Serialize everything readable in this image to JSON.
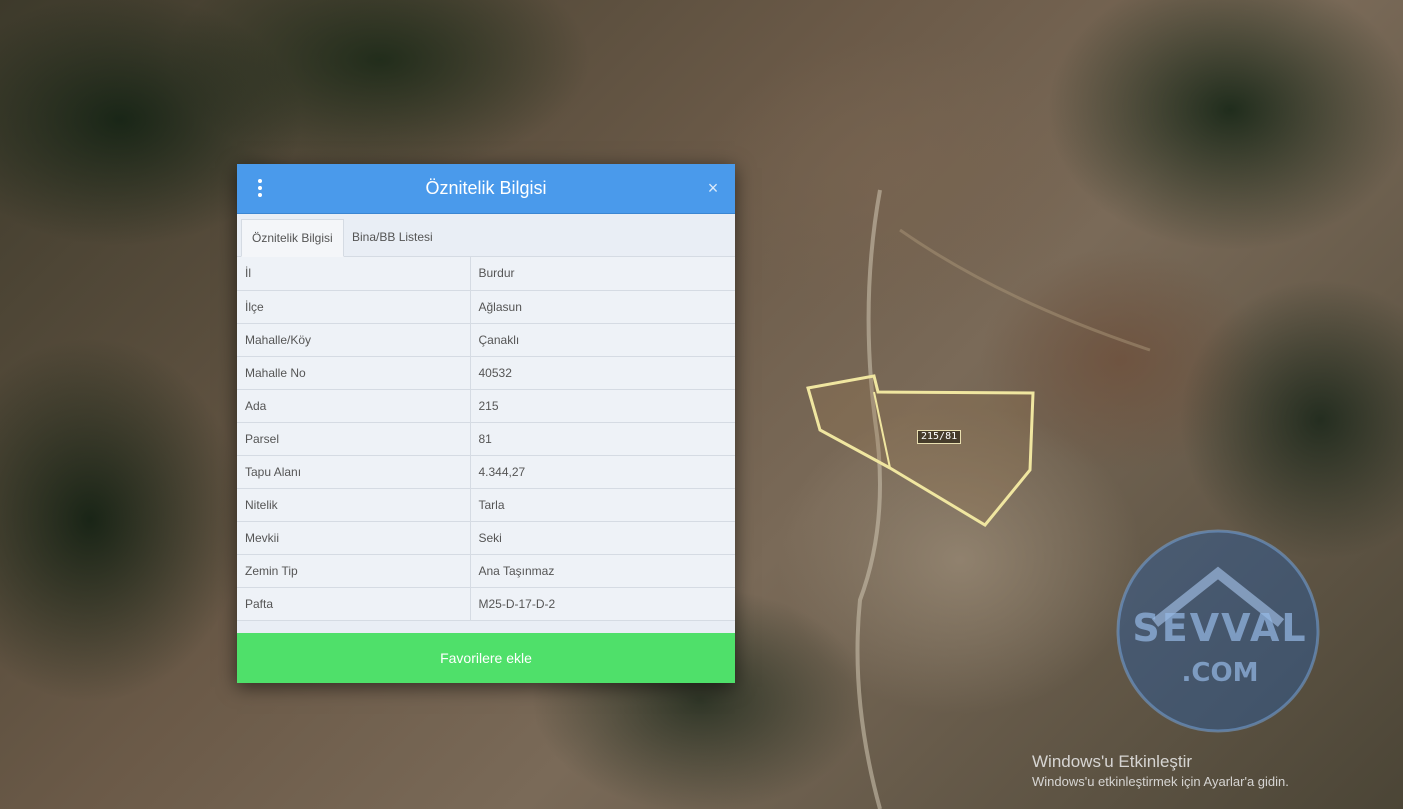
{
  "dialog": {
    "title": "Öznitelik Bilgisi",
    "tabs": [
      {
        "label": "Öznitelik Bilgisi",
        "active": true
      },
      {
        "label": "Bina/BB Listesi",
        "active": false
      }
    ],
    "rows": [
      {
        "key": "İl",
        "value": "Burdur"
      },
      {
        "key": "İlçe",
        "value": "Ağlasun"
      },
      {
        "key": "Mahalle/Köy",
        "value": "Çanaklı"
      },
      {
        "key": "Mahalle No",
        "value": "40532"
      },
      {
        "key": "Ada",
        "value": "215"
      },
      {
        "key": "Parsel",
        "value": "81"
      },
      {
        "key": "Tapu Alanı",
        "value": "4.344,27"
      },
      {
        "key": "Nitelik",
        "value": "Tarla"
      },
      {
        "key": "Mevkii",
        "value": "Seki"
      },
      {
        "key": "Zemin Tip",
        "value": "Ana Taşınmaz"
      },
      {
        "key": "Pafta",
        "value": "M25-D-17-D-2"
      }
    ],
    "favorite_label": "Favorilere ekle",
    "menu_icon": "kebab-menu-icon",
    "close_icon": "close-icon",
    "header_color": "#4a9aeb",
    "favorite_color": "#4fe06a"
  },
  "map": {
    "parcel_label": "215/81",
    "parcel_outline_color": "#f0e6a0"
  },
  "watermark": {
    "line1": "SEVVAL",
    "line2": ".COM"
  },
  "activation": {
    "title": "Windows'u Etkinleştir",
    "subtitle": "Windows'u etkinleştirmek için Ayarlar'a gidin."
  }
}
